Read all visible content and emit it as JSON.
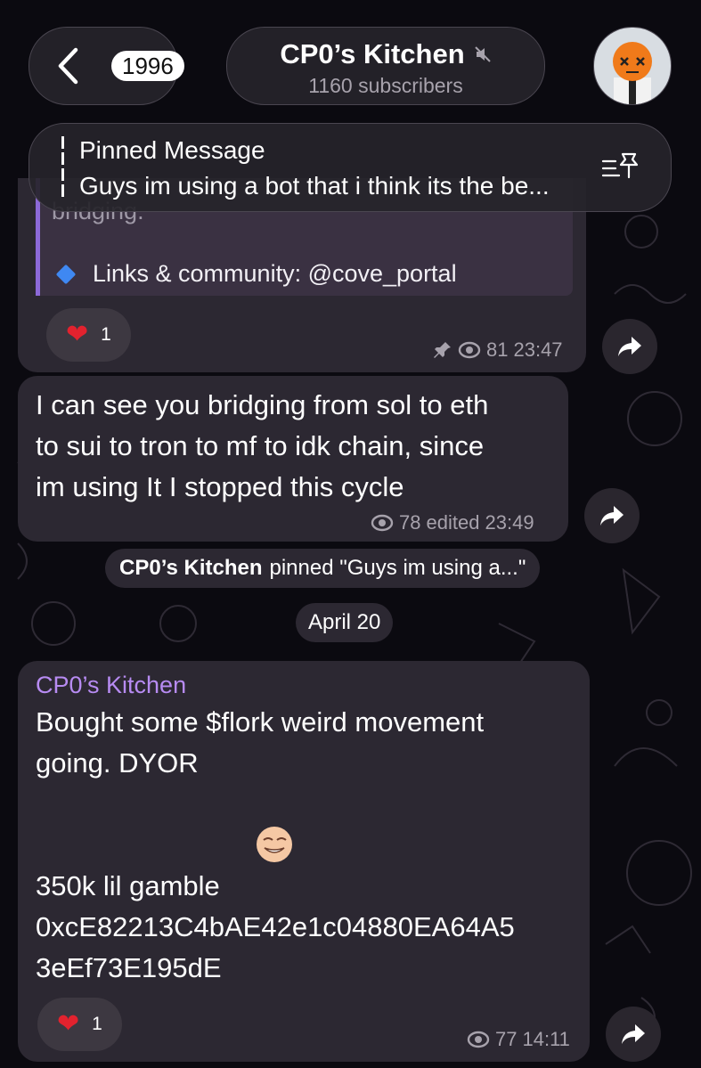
{
  "header": {
    "back_count": "1996",
    "channel_title": "CP0’s Kitchen",
    "subscribers": "1160 subscribers"
  },
  "pinned": {
    "title": "Pinned Message",
    "text": "Guys im using a bot that i think its the be..."
  },
  "message1": {
    "faded_text": "bridging.",
    "link_line": "Links & community: @cove_portal",
    "reaction_count": "1",
    "views": "81",
    "time": "23:47"
  },
  "message2": {
    "text": "I can see you bridging from sol to eth\nto sui to tron to mf to idk chain, since\nim using It I stopped this cycle",
    "views": "78",
    "edited_time": "edited 23:49"
  },
  "service": {
    "actor": "CP0’s Kitchen",
    "action": "pinned \"Guys im using a...\""
  },
  "date_pill": "April 20",
  "message3": {
    "author": "CP0’s Kitchen",
    "line1": "Bought some $flork weird movement\ngoing. DYOR",
    "line2": "350k lil gamble",
    "line3": "0xcE82213C4bAE42e1c04880EA64A5\n3eEf73E195dE",
    "reaction_count": "1",
    "views": "77",
    "time": "14:11"
  },
  "icons": {
    "back": "chevron-left-icon",
    "mute": "muted-speaker-icon",
    "pin_list": "pinned-list-icon",
    "heart": "heart-reaction-icon",
    "eye": "views-eye-icon",
    "pin": "pin-icon",
    "share": "share-arrow-icon",
    "emoji": "grinning-face-emoji",
    "diamond": "blue-diamond-emoji"
  },
  "colors": {
    "bubble": "#2c2832",
    "accent_author": "#b78bf2",
    "quote_bar": "#8c69d8",
    "heart": "#e2222e"
  }
}
